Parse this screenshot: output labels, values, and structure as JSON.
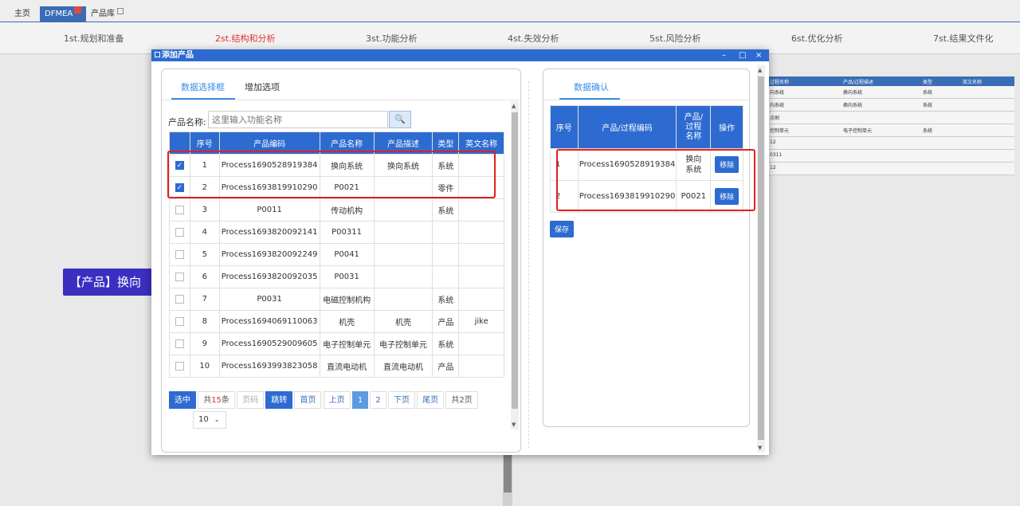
{
  "top_tabs": [
    "主页",
    "DFMEA",
    "产品库"
  ],
  "steps": [
    "1st.规划和准备",
    "2st.结构和分析",
    "3st.功能分析",
    "4st.失效分析",
    "5st.风险分析",
    "6st.优化分析",
    "7st.结果文件化"
  ],
  "active_step": 1,
  "background": {
    "banner": "【产品】换向",
    "table_headers": [
      "过程名称",
      "产品/过程描述",
      "类型",
      "英文名称"
    ],
    "rows": [
      [
        "向系统",
        "换向系统",
        "系统",
        ""
      ],
      [
        "向系统",
        "换向系统",
        "系统",
        ""
      ],
      [
        "点刷",
        "",
        "",
        ""
      ],
      [
        "控制单元",
        "电子控制单元",
        "系统",
        ""
      ],
      [
        "12",
        "",
        "",
        ""
      ],
      [
        "0311",
        "",
        "",
        ""
      ],
      [
        "12",
        "",
        "",
        ""
      ]
    ]
  },
  "modal": {
    "title": "添加产品",
    "controls": [
      "–",
      "□",
      "×"
    ],
    "left": {
      "tabs": [
        "数据选择框",
        "增加选项"
      ],
      "search_label": "产品名称:",
      "search_placeholder": "这里输入功能名称",
      "headers": [
        "序号",
        "产品编码",
        "产品名称",
        "产品描述",
        "类型",
        "英文名称"
      ],
      "rows": [
        {
          "checked": true,
          "cells": [
            "1",
            "Process1690528919384",
            "换向系统",
            "换向系统",
            "系统",
            ""
          ]
        },
        {
          "checked": true,
          "cells": [
            "2",
            "Process1693819910290",
            "P0021",
            "",
            "零件",
            ""
          ]
        },
        {
          "checked": false,
          "cells": [
            "3",
            "P0011",
            "传动机构",
            "",
            "系统",
            ""
          ]
        },
        {
          "checked": false,
          "cells": [
            "4",
            "Process1693820092141",
            "P00311",
            "",
            "",
            ""
          ]
        },
        {
          "checked": false,
          "cells": [
            "5",
            "Process1693820092249",
            "P0041",
            "",
            "",
            ""
          ]
        },
        {
          "checked": false,
          "cells": [
            "6",
            "Process1693820092035",
            "P0031",
            "",
            "",
            ""
          ]
        },
        {
          "checked": false,
          "cells": [
            "7",
            "P0031",
            "电磁控制机构",
            "",
            "系统",
            ""
          ]
        },
        {
          "checked": false,
          "cells": [
            "8",
            "Process1694069110063",
            "机壳",
            "机壳",
            "产品",
            "jike"
          ]
        },
        {
          "checked": false,
          "cells": [
            "9",
            "Process1690529009605",
            "电子控制单元",
            "电子控制单元",
            "系统",
            ""
          ]
        },
        {
          "checked": false,
          "cells": [
            "10",
            "Process1693993823058",
            "直流电动机",
            "直流电动机",
            "产品",
            ""
          ]
        }
      ],
      "pager": {
        "select_btn": "选中",
        "total_prefix": "共",
        "total": "15",
        "total_suffix": "条",
        "page_input": "页码",
        "jump": "跳转",
        "first": "首页",
        "prev": "上页",
        "pages": [
          "1",
          "2"
        ],
        "current_page": "1",
        "next": "下页",
        "last": "尾页",
        "page_count": "共2页",
        "page_size": "10"
      }
    },
    "right": {
      "tab": "数据确认",
      "headers": [
        "序号",
        "产品/过程编码",
        "产品/\n过程\n名称",
        "操作"
      ],
      "rows": [
        {
          "cells": [
            "1",
            "Process1690528919384",
            "换向\n系统"
          ],
          "action": "移除"
        },
        {
          "cells": [
            "2",
            "Process1693819910290",
            "P0021"
          ],
          "action": "移除"
        }
      ],
      "save": "保存"
    }
  }
}
